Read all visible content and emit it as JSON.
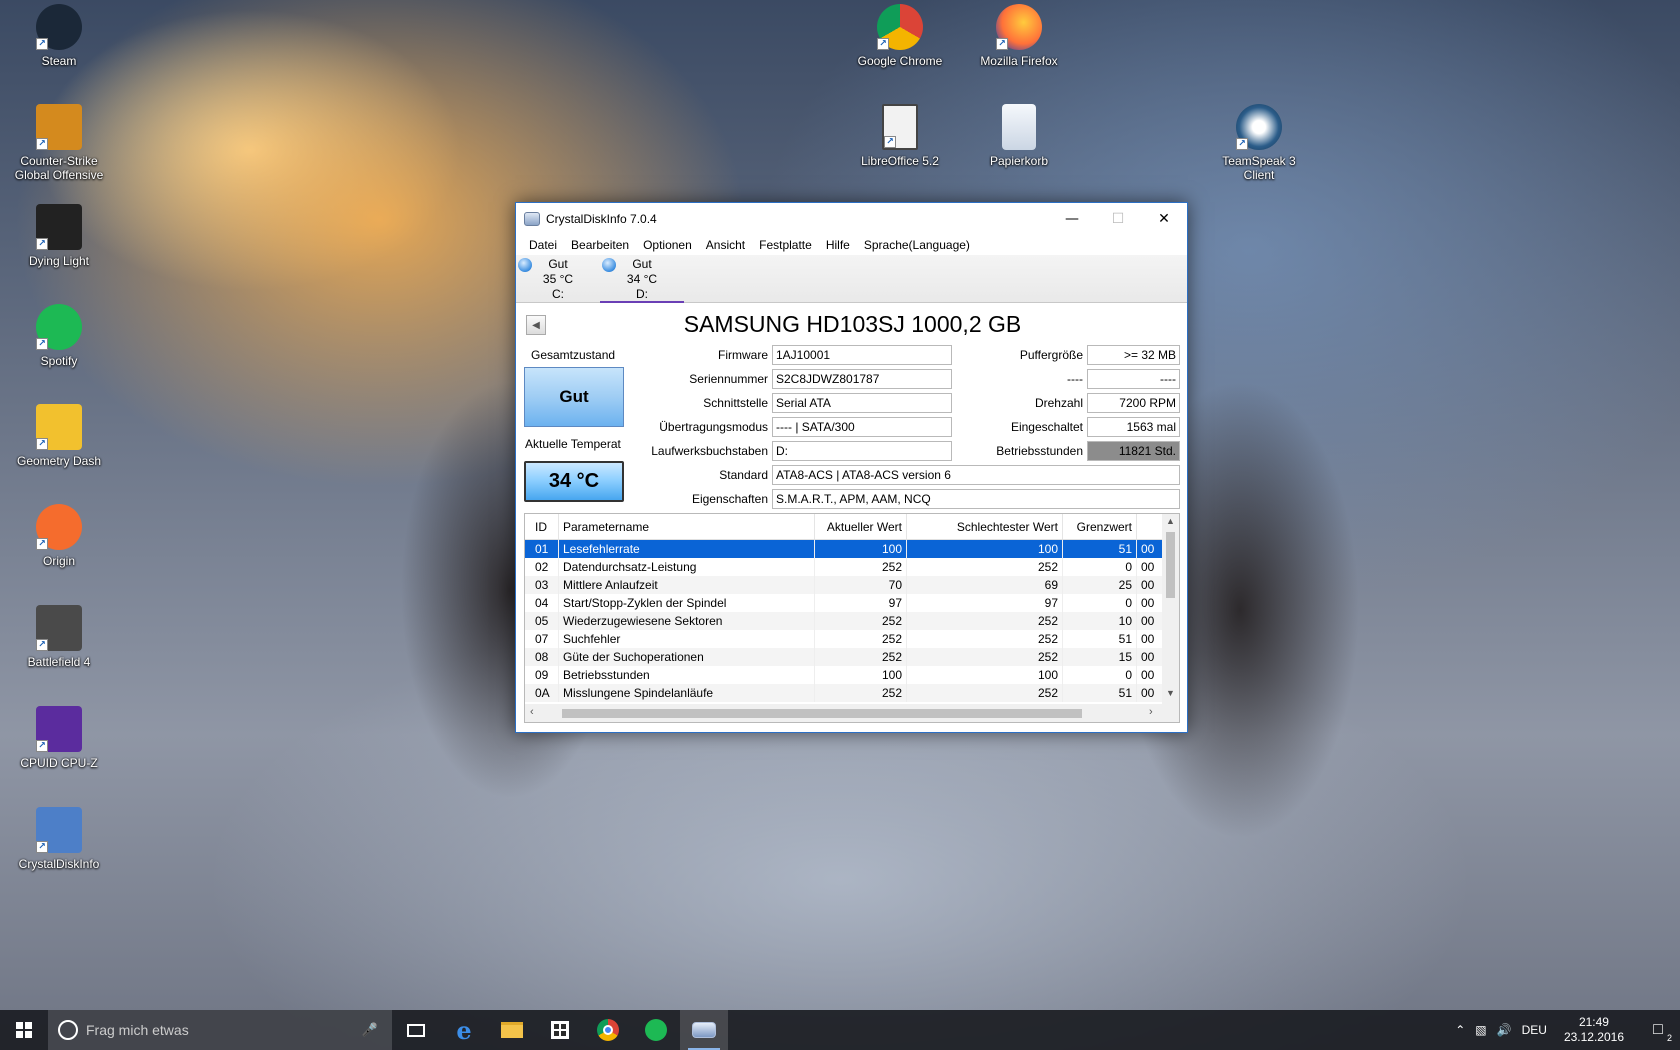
{
  "desktop": {
    "icons_left": [
      {
        "label": "Steam",
        "icon": "steam-icon",
        "color": "#1b2838"
      },
      {
        "label": "Counter-Strike Global Offensive",
        "icon": "csgo-icon",
        "color": "#d48a1e"
      },
      {
        "label": "Dying Light",
        "icon": "dying-light-icon",
        "color": "#222222"
      },
      {
        "label": "Spotify",
        "icon": "spotify-icon",
        "color": "#1db954"
      },
      {
        "label": "Geometry Dash",
        "icon": "geometry-dash-icon",
        "color": "#f2c12e"
      },
      {
        "label": "Origin",
        "icon": "origin-icon",
        "color": "#f56c2d"
      },
      {
        "label": "Battlefield 4",
        "icon": "battlefield-icon",
        "color": "#4a4a4a"
      },
      {
        "label": "CPUID CPU-Z",
        "icon": "cpu-z-icon",
        "color": "#5b2c9e"
      },
      {
        "label": "CrystalDiskInfo",
        "icon": "crystaldiskinfo-icon",
        "color": "#4d7fc8"
      }
    ],
    "icons_top": [
      {
        "label": "Google Chrome",
        "icon": "chrome-icon"
      },
      {
        "label": "Mozilla Firefox",
        "icon": "firefox-icon"
      },
      {
        "label": "LibreOffice 5.2",
        "icon": "libreoffice-icon"
      },
      {
        "label": "Papierkorb",
        "icon": "recycle-bin-icon"
      },
      {
        "label": "TeamSpeak 3 Client",
        "icon": "teamspeak-icon"
      }
    ]
  },
  "window": {
    "title": "CrystalDiskInfo 7.0.4",
    "menu": [
      "Datei",
      "Bearbeiten",
      "Optionen",
      "Ansicht",
      "Festplatte",
      "Hilfe",
      "Sprache(Language)"
    ],
    "drives": [
      {
        "status": "Gut",
        "temp": "35 °C",
        "letter": "C:",
        "selected": false
      },
      {
        "status": "Gut",
        "temp": "34 °C",
        "letter": "D:",
        "selected": true
      }
    ],
    "model": "SAMSUNG HD103SJ 1000,2 GB",
    "health_label": "Gesamtzustand",
    "health_value": "Gut",
    "temp_label": "Aktuelle Temperat",
    "temp_value": "34 °C",
    "fields": {
      "firmware_label": "Firmware",
      "firmware": "1AJ10001",
      "serial_label": "Seriennummer",
      "serial": "S2C8JDWZ801787",
      "interface_label": "Schnittstelle",
      "interface": "Serial ATA",
      "transfer_label": "Übertragungsmodus",
      "transfer": "---- | SATA/300",
      "drive_letter_label": "Laufwerksbuchstaben",
      "drive_letter": "D:",
      "standard_label": "Standard",
      "standard": "ATA8-ACS | ATA8-ACS version 6",
      "features_label": "Eigenschaften",
      "features": "S.M.A.R.T., APM, AAM, NCQ",
      "buffer_label": "Puffergröße",
      "buffer": ">= 32 MB",
      "nv_label": "----",
      "nv": "----",
      "rpm_label": "Drehzahl",
      "rpm": "7200 RPM",
      "power_on_count_label": "Eingeschaltet",
      "power_on_count": "1563 mal",
      "power_on_hours_label": "Betriebsstunden",
      "power_on_hours": "11821 Std."
    },
    "smart": {
      "columns": [
        "ID",
        "Parametername",
        "Aktueller Wert",
        "Schlechtester Wert",
        "Grenzwert",
        ""
      ],
      "rows": [
        {
          "id": "01",
          "name": "Lesefehlerrate",
          "cur": "100",
          "worst": "100",
          "th": "51",
          "raw": "00"
        },
        {
          "id": "02",
          "name": "Datendurchsatz-Leistung",
          "cur": "252",
          "worst": "252",
          "th": "0",
          "raw": "00"
        },
        {
          "id": "03",
          "name": "Mittlere Anlaufzeit",
          "cur": "70",
          "worst": "69",
          "th": "25",
          "raw": "00"
        },
        {
          "id": "04",
          "name": "Start/Stopp-Zyklen der Spindel",
          "cur": "97",
          "worst": "97",
          "th": "0",
          "raw": "00"
        },
        {
          "id": "05",
          "name": "Wiederzugewiesene Sektoren",
          "cur": "252",
          "worst": "252",
          "th": "10",
          "raw": "00"
        },
        {
          "id": "07",
          "name": "Suchfehler",
          "cur": "252",
          "worst": "252",
          "th": "51",
          "raw": "00"
        },
        {
          "id": "08",
          "name": "Güte der Suchoperationen",
          "cur": "252",
          "worst": "252",
          "th": "15",
          "raw": "00"
        },
        {
          "id": "09",
          "name": "Betriebsstunden",
          "cur": "100",
          "worst": "100",
          "th": "0",
          "raw": "00"
        },
        {
          "id": "0A",
          "name": "Misslungene Spindelanläufe",
          "cur": "252",
          "worst": "252",
          "th": "51",
          "raw": "00"
        }
      ]
    }
  },
  "taskbar": {
    "search_placeholder": "Frag mich etwas",
    "language": "DEU",
    "time": "21:49",
    "date": "23.12.2016",
    "notifications": "2"
  }
}
